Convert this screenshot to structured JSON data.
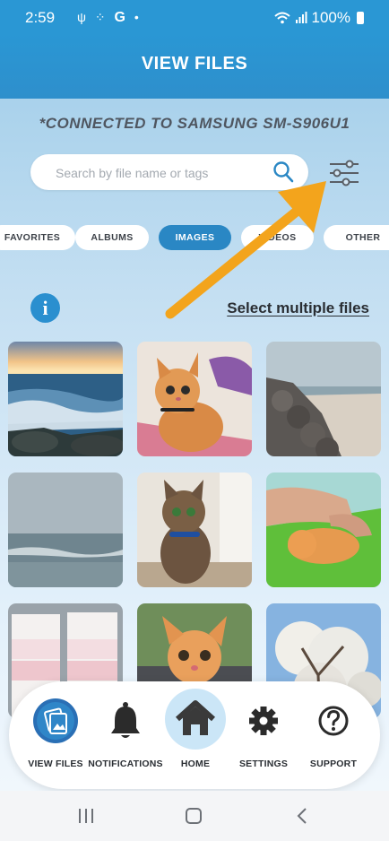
{
  "status_bar": {
    "time": "2:59",
    "notification_letter": "G",
    "battery": "100%"
  },
  "header": {
    "title": "VIEW FILES"
  },
  "connection": {
    "text": "*CONNECTED TO SAMSUNG SM-S906U1"
  },
  "search": {
    "placeholder": "Search by file name or tags",
    "value": ""
  },
  "tabs": [
    {
      "label": "FAVORITES",
      "active": false
    },
    {
      "label": "ALBUMS",
      "active": false
    },
    {
      "label": "IMAGES",
      "active": true
    },
    {
      "label": "VIDEOS",
      "active": false
    },
    {
      "label": "OTHER",
      "active": false
    }
  ],
  "select_multiple_label": "Select multiple files",
  "images": [
    {
      "subject": "ocean sunset waves on rocks"
    },
    {
      "subject": "orange kitten on blanket"
    },
    {
      "subject": "foggy beach with jetty rocks"
    },
    {
      "subject": "foggy ocean waves"
    },
    {
      "subject": "tabby cat sitting on floor"
    },
    {
      "subject": "orange kitten sleeping on green blanket"
    },
    {
      "subject": "paint swatch cards"
    },
    {
      "subject": "orange kitten in car"
    },
    {
      "subject": "blossoming tree against sky"
    }
  ],
  "bottom_nav": [
    {
      "label": "VIEW FILES",
      "icon": "view-files-icon",
      "selected": true
    },
    {
      "label": "NOTIFICATIONS",
      "icon": "bell-icon",
      "selected": false
    },
    {
      "label": "HOME",
      "icon": "home-icon",
      "selected": false
    },
    {
      "label": "SETTINGS",
      "icon": "gear-icon",
      "selected": false
    },
    {
      "label": "SUPPORT",
      "icon": "question-icon",
      "selected": false
    }
  ],
  "colors": {
    "primary": "#2a97d4",
    "active_tab": "#2a87c4",
    "annotation_arrow": "#f3a41c"
  }
}
